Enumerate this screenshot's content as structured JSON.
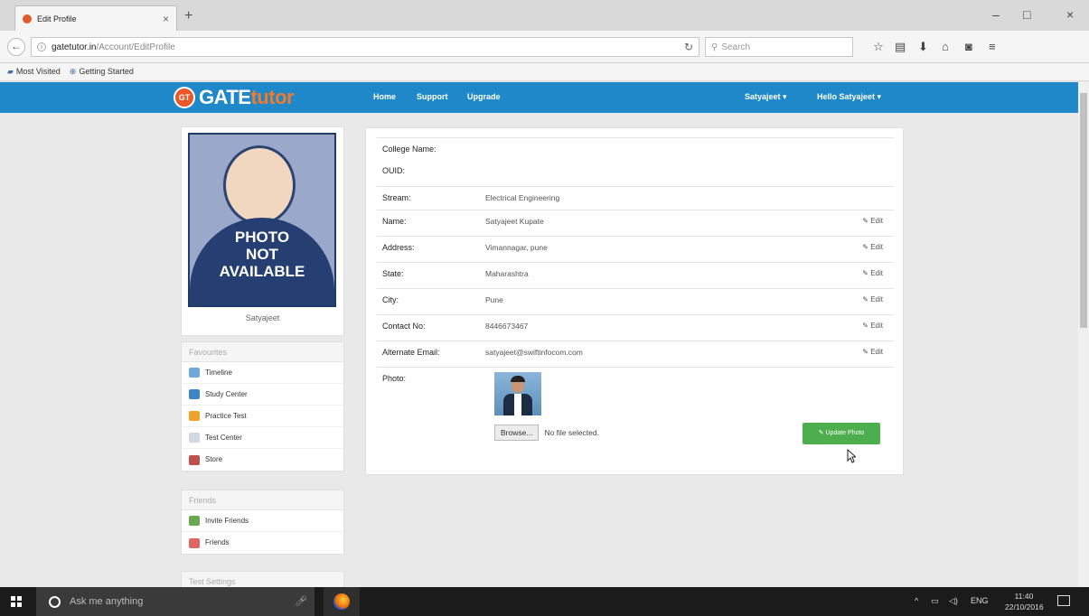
{
  "browser": {
    "tab_title": "Edit Profile",
    "tab_close": "×",
    "new_tab": "+",
    "url_host": "gatetutor.in",
    "url_path": "/Account/EditProfile",
    "search_placeholder": "Search",
    "bookmarks": [
      "Most Visited",
      "Getting Started"
    ],
    "window_controls": [
      "–",
      "□",
      "×"
    ],
    "toolbar_icons": [
      "star-icon",
      "reader-icon",
      "download-icon",
      "home-icon",
      "pocket-icon",
      "menu-icon"
    ]
  },
  "site": {
    "logo_badge": "GT",
    "logo_gate": "GATE",
    "logo_tutor": "tutor",
    "nav": [
      "Home",
      "Support",
      "Upgrade"
    ],
    "user_menu": "Satyajeet ▾",
    "hello_menu": "Hello Satyajeet ▾",
    "colors": {
      "header": "#1f88c9",
      "accent": "#f27a2f",
      "update_button": "#4cae4c"
    }
  },
  "sidebar": {
    "photo_text": [
      "PHOTO",
      "NOT",
      "AVAILABLE"
    ],
    "user_name": "Satyajeet",
    "favourites_title": "Favourites",
    "favourites": [
      {
        "label": "Timeline",
        "icon": "timeline-icon"
      },
      {
        "label": "Study Center",
        "icon": "study-center-icon"
      },
      {
        "label": "Practice Test",
        "icon": "practice-test-icon"
      },
      {
        "label": "Test Center",
        "icon": "test-center-icon"
      },
      {
        "label": "Store",
        "icon": "store-icon"
      }
    ],
    "friends_title": "Friends",
    "friends": [
      {
        "label": "Invite Friends",
        "icon": "invite-friends-icon"
      },
      {
        "label": "Friends",
        "icon": "friends-icon"
      }
    ],
    "test_settings_title": "Test Settings"
  },
  "profile": {
    "rows": [
      {
        "label": "College Name:",
        "value": "",
        "edit": ""
      },
      {
        "label": "OUID:",
        "value": "",
        "edit": ""
      },
      {
        "label": "Stream:",
        "value": "Electrical Engineering",
        "edit": ""
      },
      {
        "label": "Name:",
        "value": "Satyajeet Kupate",
        "edit": "✎ Edit"
      },
      {
        "label": "Address:",
        "value": "Vimannagar, pune",
        "edit": "✎ Edit"
      },
      {
        "label": "State:",
        "value": "Maharashtra",
        "edit": "✎ Edit"
      },
      {
        "label": "City:",
        "value": "Pune",
        "edit": "✎ Edit"
      },
      {
        "label": "Contact No:",
        "value": "8446673467",
        "edit": "✎ Edit"
      },
      {
        "label": "Alternate Email:",
        "value": "satyajeet@swiftinfocom.com",
        "edit": "✎ Edit"
      }
    ],
    "photo_label": "Photo:",
    "browse_label": "Browse...",
    "no_file": "No file selected.",
    "update_photo": "✎ Update Photo"
  },
  "taskbar": {
    "search_placeholder": "Ask me anything",
    "language": "ENG",
    "time": "11:40",
    "date": "22/10/2016",
    "tray_up": "^"
  }
}
